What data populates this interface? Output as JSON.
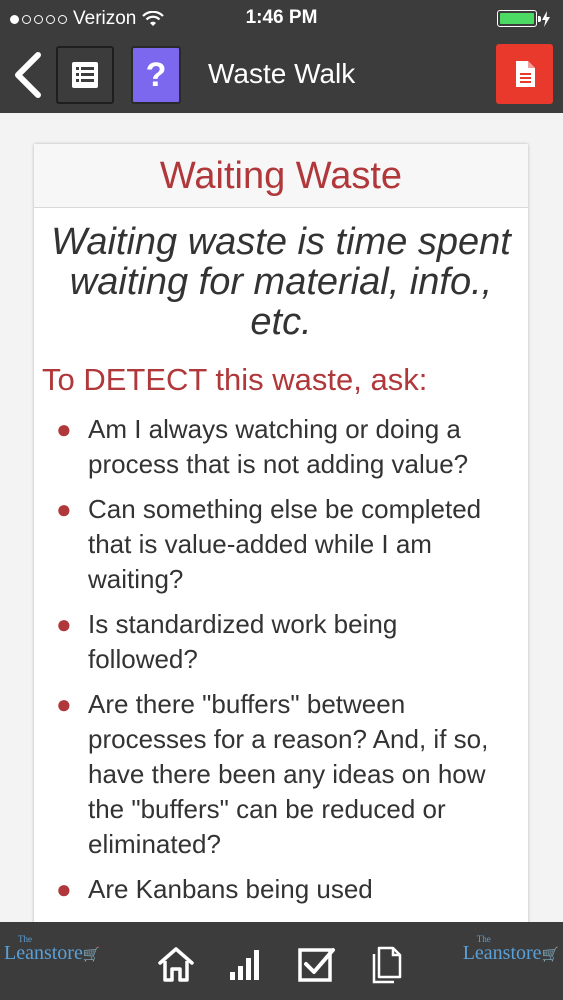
{
  "status": {
    "carrier": "Verizon",
    "time": "1:46 PM",
    "battery_color": "#4cd964"
  },
  "nav": {
    "title": "Waste Walk",
    "back_icon": "chevron-left-icon",
    "list_icon": "list-icon",
    "help_label": "?",
    "doc_icon": "document-icon",
    "help_color": "#7b68ee",
    "doc_color": "#e8392c"
  },
  "card": {
    "title": "Waiting Waste",
    "definition": "Waiting waste is time spent waiting for material, info., etc.",
    "detect_heading": "To DETECT this waste, ask:",
    "questions": [
      "Am I always watching or doing a process that is not adding value?",
      "Can something else be completed that is value-added while I am waiting?",
      "Is standardized work being followed?",
      "Are there \"buffers\" between processes for a reason? And, if so, have there been any ideas on how the \"buffers\" can be reduced or eliminated?",
      "Are Kanbans being used"
    ],
    "accent_color": "#b0373a"
  },
  "tabbar": {
    "logo_text": "Leanstore",
    "logo_prefix": "The",
    "tabs": [
      "home-icon",
      "stats-icon",
      "checkbox-icon",
      "documents-icon"
    ]
  }
}
